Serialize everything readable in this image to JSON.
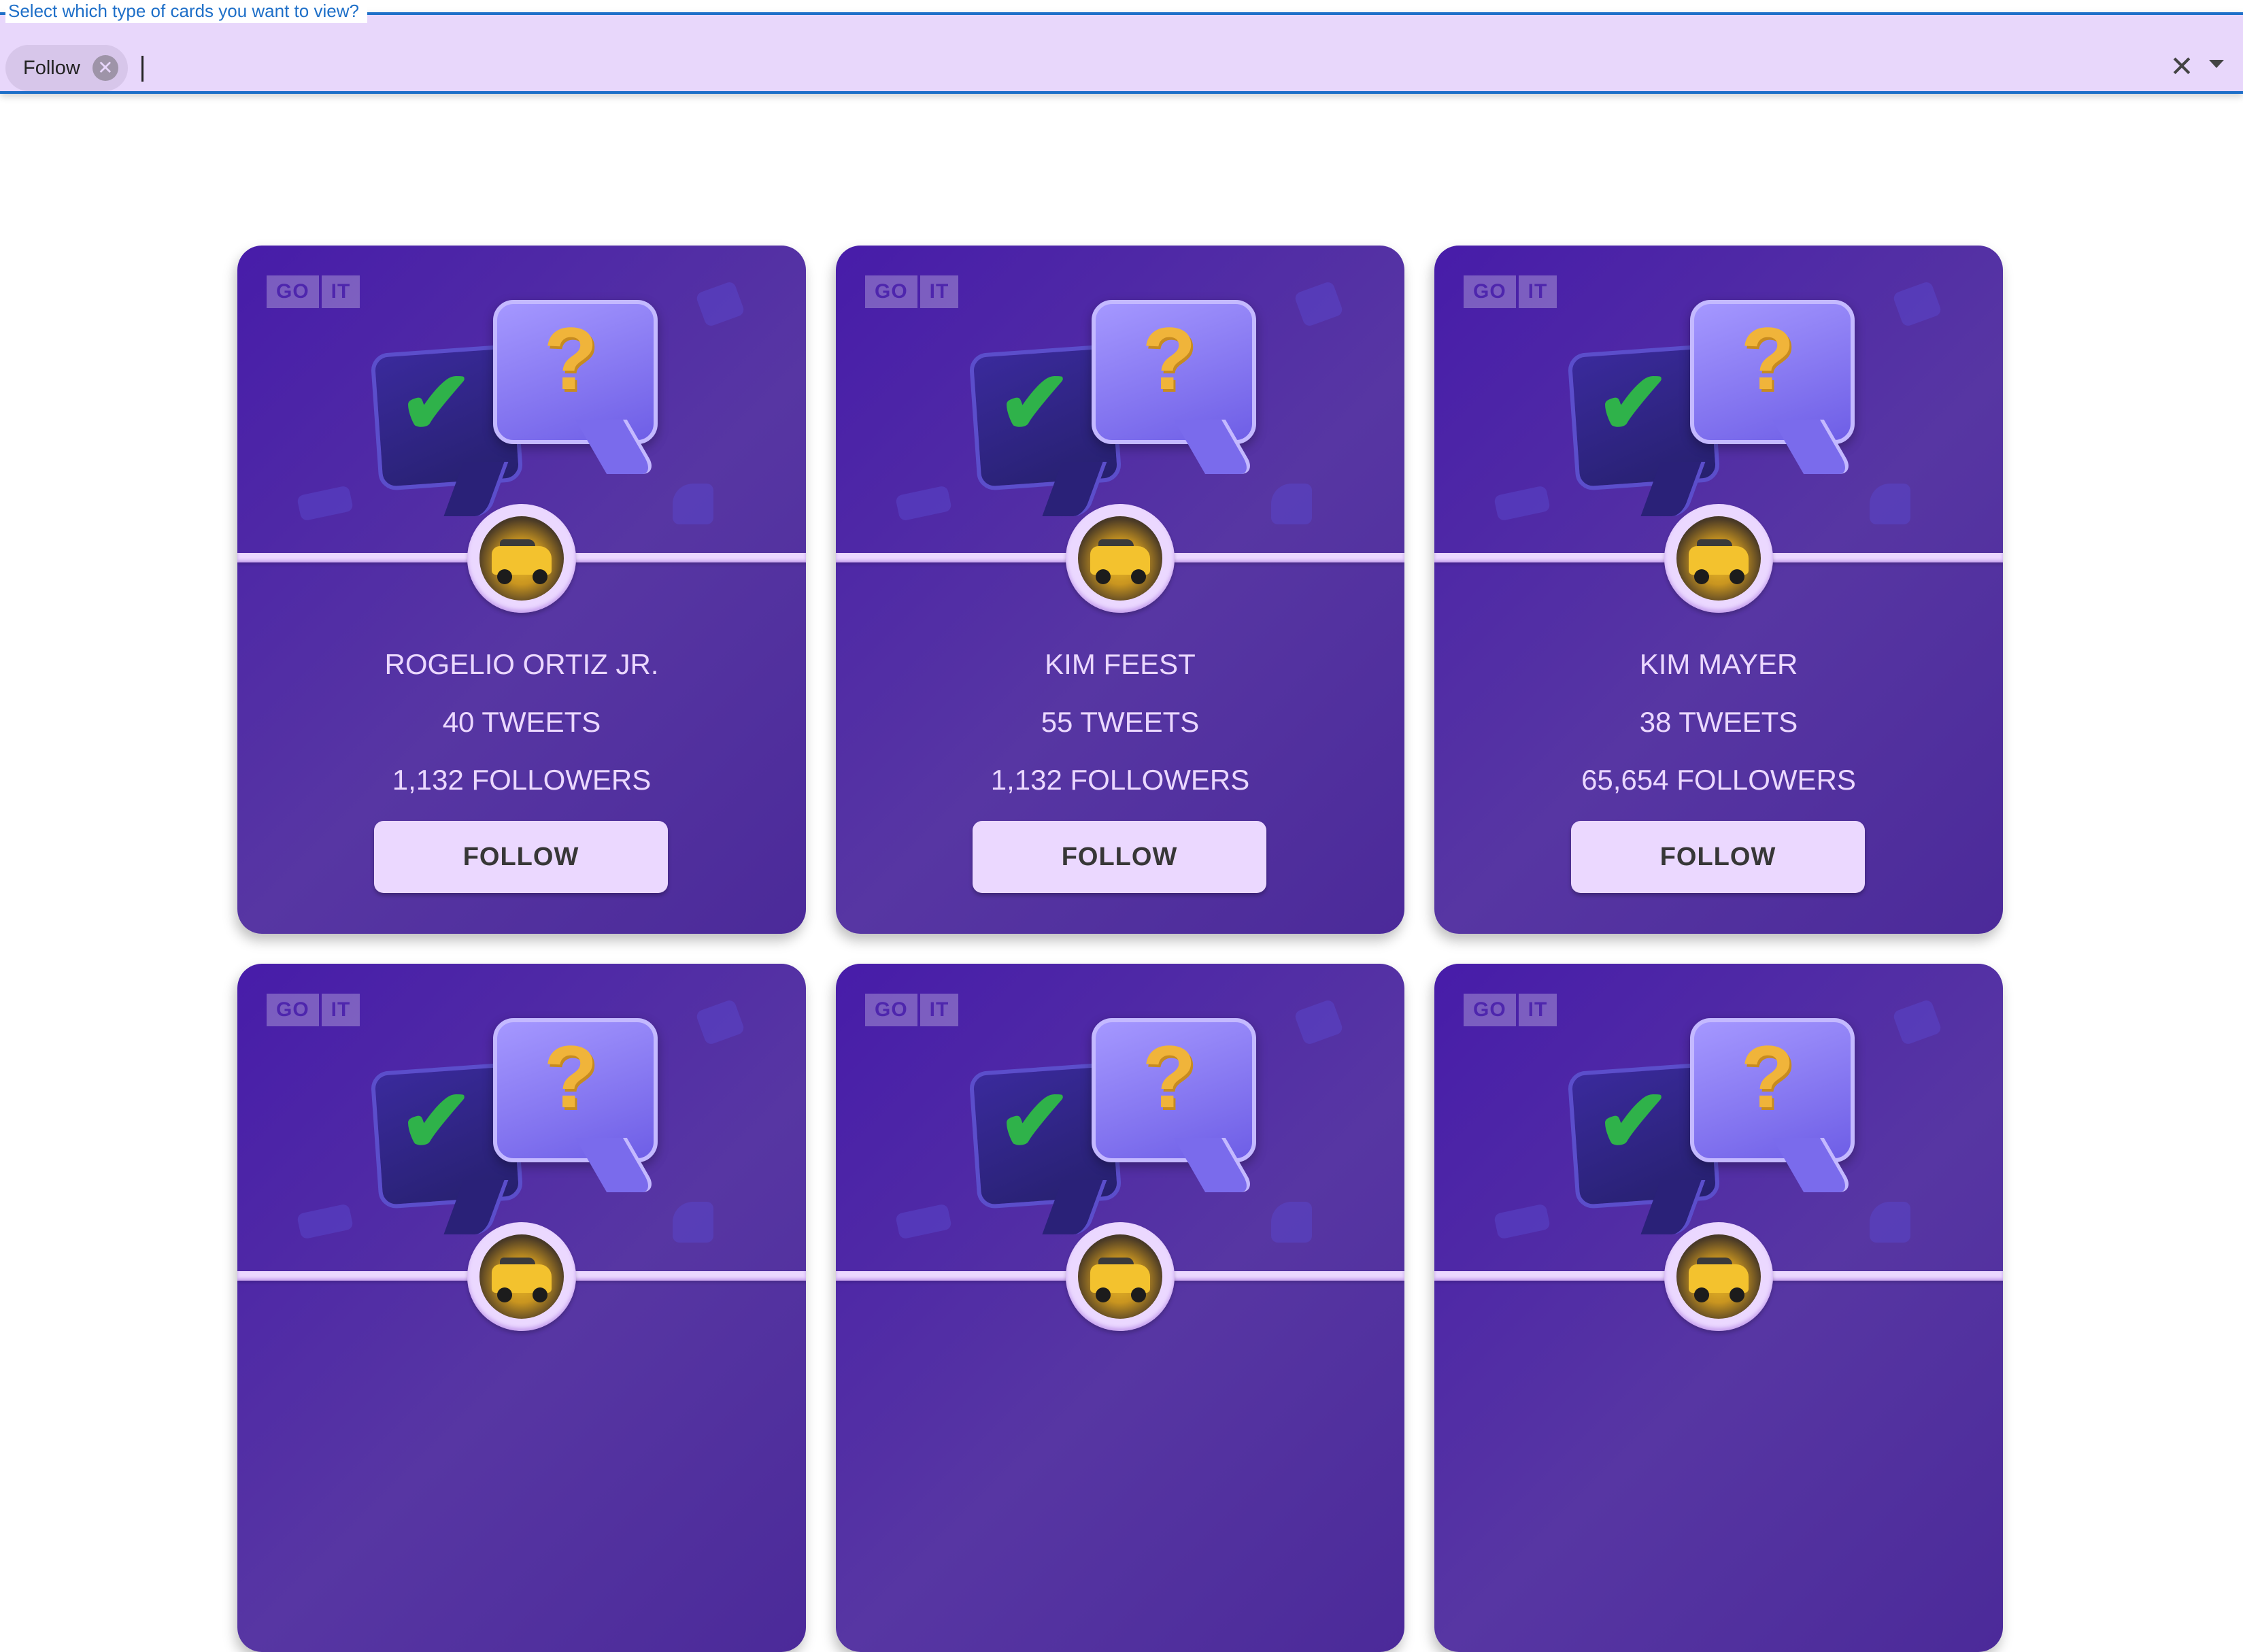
{
  "filter": {
    "legend": "Select which type of cards you want to view?",
    "selected_chip": "Follow",
    "input_value": "",
    "clear_icon": "close-icon",
    "dropdown_icon": "caret-down-icon"
  },
  "card_logo": [
    "GO",
    "IT"
  ],
  "cards": [
    {
      "name": "ROGELIO ORTIZ JR.",
      "tweets": "40 TWEETS",
      "followers": "1,132 FOLLOWERS",
      "button": "FOLLOW"
    },
    {
      "name": "KIM FEEST",
      "tweets": "55 TWEETS",
      "followers": "1,132 FOLLOWERS",
      "button": "FOLLOW"
    },
    {
      "name": "KIM MAYER",
      "tweets": "38 TWEETS",
      "followers": "65,654 FOLLOWERS",
      "button": "FOLLOW"
    },
    {
      "name": "",
      "tweets": "",
      "followers": "",
      "button": ""
    },
    {
      "name": "",
      "tweets": "",
      "followers": "",
      "button": ""
    },
    {
      "name": "",
      "tweets": "",
      "followers": "",
      "button": ""
    }
  ],
  "colors": {
    "card_background": "#471ca9",
    "accent_light": "#ebd8ff",
    "filter_background": "#e8d7fb",
    "focus_border": "#1e6fc8"
  }
}
